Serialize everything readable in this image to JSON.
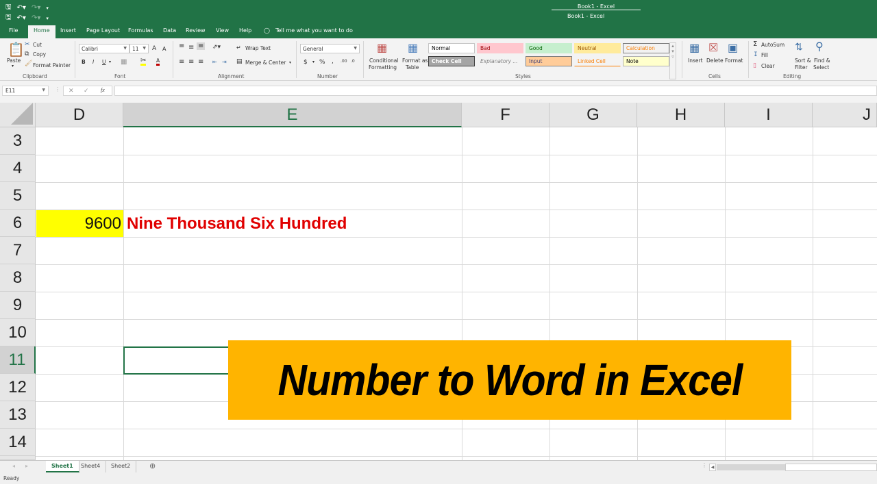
{
  "window": {
    "title_top": "Book1  -  Excel",
    "title": "Book1  -  Excel"
  },
  "qat": {
    "save_icon": "save-icon",
    "undo_icon": "undo-icon",
    "redo_icon": "redo-icon",
    "customize_icon": "customize-qat-icon"
  },
  "ribbon_tabs": [
    {
      "label": "File"
    },
    {
      "label": "Home",
      "active": true
    },
    {
      "label": "Insert"
    },
    {
      "label": "Page Layout"
    },
    {
      "label": "Formulas"
    },
    {
      "label": "Data"
    },
    {
      "label": "Review"
    },
    {
      "label": "View"
    },
    {
      "label": "Help"
    }
  ],
  "tell_me": "Tell me what you want to do",
  "clipboard": {
    "paste": "Paste",
    "cut": "Cut",
    "copy": "Copy",
    "format_painter": "Format Painter",
    "group": "Clipboard"
  },
  "font": {
    "name": "Calibri",
    "size": "11",
    "bold": "B",
    "italic": "I",
    "underline": "U",
    "grow": "A",
    "shrink": "A",
    "font_color": "A",
    "group": "Font",
    "highlight_color": "#ffff00",
    "text_color": "#c00000"
  },
  "alignment": {
    "wrap_text": "Wrap Text",
    "merge_center": "Merge & Center",
    "group": "Alignment"
  },
  "number": {
    "format": "General",
    "currency": "$",
    "percent": "%",
    "comma": ",",
    "inc_decimal": ".00",
    "dec_decimal": ".0",
    "group": "Number"
  },
  "styles": {
    "conditional_formatting": [
      "Conditional",
      "Formatting"
    ],
    "format_as_table": [
      "Format as",
      "Table"
    ],
    "cells": [
      {
        "label": "Normal",
        "bg": "#ffffff",
        "color": "#000000",
        "border": "#c6c6c6"
      },
      {
        "label": "Bad",
        "bg": "#ffc7ce",
        "color": "#9c0006",
        "border": "#ffc7ce"
      },
      {
        "label": "Good",
        "bg": "#c6efce",
        "color": "#006100",
        "border": "#c6efce"
      },
      {
        "label": "Neutral",
        "bg": "#ffeb9c",
        "color": "#9c5700",
        "border": "#ffeb9c"
      },
      {
        "label": "Calculation",
        "bg": "#f2f2f2",
        "color": "#fa7d00",
        "border": "#7f7f7f"
      },
      {
        "label": "Check Cell",
        "bg": "#a5a5a5",
        "color": "#ffffff",
        "border": "#3f3f3f"
      },
      {
        "label": "Explanatory ...",
        "bg": "#f3f3f3",
        "color": "#7f7f7f",
        "border": "#f3f3f3"
      },
      {
        "label": "Input",
        "bg": "#ffcc99",
        "color": "#3f3f76",
        "border": "#7f7f7f"
      },
      {
        "label": "Linked Cell",
        "bg": "#f3f3f3",
        "color": "#fa7d00",
        "border": "#f3f3f3"
      },
      {
        "label": "Note",
        "bg": "#ffffcc",
        "color": "#000000",
        "border": "#b2b2b2"
      }
    ],
    "group": "Styles"
  },
  "cells_group": {
    "insert": "Insert",
    "delete": "Delete",
    "format": "Format",
    "group": "Cells"
  },
  "editing": {
    "autosum": "AutoSum",
    "fill": "Fill",
    "clear": "Clear",
    "sort_filter": [
      "Sort &",
      "Filter"
    ],
    "find_select": [
      "Find &",
      "Select"
    ],
    "group": "Editing"
  },
  "formula_bar": {
    "name_box": "E11",
    "cancel": "✕",
    "enter": "✓",
    "fx": "fx",
    "value": ""
  },
  "grid": {
    "columns": [
      "D",
      "E",
      "F",
      "G",
      "H",
      "I",
      "J"
    ],
    "selected_column": "E",
    "rows": [
      "3",
      "4",
      "5",
      "6",
      "7",
      "8",
      "9",
      "10",
      "11",
      "12",
      "13",
      "14"
    ],
    "selected_row": "11",
    "cells": {
      "D6": "9600",
      "E6": "Nine Thousand Six Hundred"
    },
    "active_cell": "E11",
    "d6_fill": "#ffff00",
    "e6_color": "#e00000"
  },
  "banner": {
    "text": "Number to Word in Excel",
    "bg": "#ffb400"
  },
  "sheets": [
    {
      "label": "Sheet1",
      "active": true
    },
    {
      "label": "Sheet4"
    },
    {
      "label": "Sheet2"
    }
  ],
  "status": {
    "text": "Ready"
  },
  "accent": "#217346"
}
